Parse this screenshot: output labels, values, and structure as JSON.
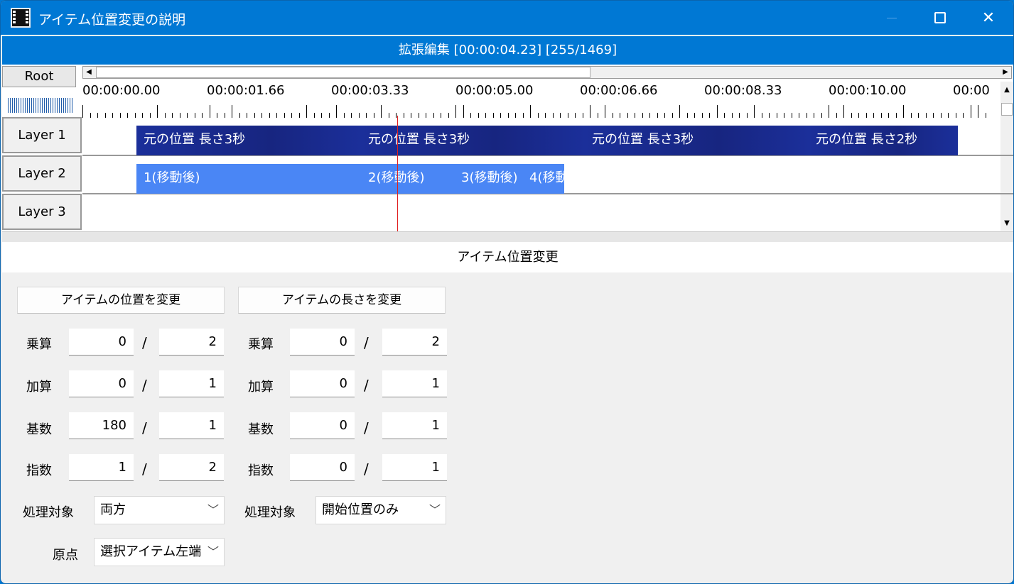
{
  "window": {
    "title": "アイテム位置変更の説明",
    "min": "",
    "max": "",
    "close": "✕"
  },
  "editor": {
    "header": "拡張編集 [00:00:04.23] [255/1469]",
    "root": "Root"
  },
  "ruler": {
    "labels": [
      "00:00:00.00",
      "00:00:01.66",
      "00:00:03.33",
      "00:00:05.00",
      "00:00:06.66",
      "00:00:08.33",
      "00:00:10.00",
      "00:00"
    ]
  },
  "layers": [
    "Layer  1",
    "Layer  2",
    "Layer  3"
  ],
  "clips": {
    "layer1": [
      "元の位置 長さ3秒",
      "元の位置 長さ3秒",
      "元の位置 長さ3秒",
      "元の位置 長さ2秒"
    ],
    "layer2": [
      "1(移動後)",
      "2(移動後)",
      "3(移動後)",
      "4(移動"
    ]
  },
  "panel": {
    "title": "アイテム位置変更",
    "position_button": "アイテムの位置を変更",
    "length_button": "アイテムの長さを変更",
    "labels": {
      "mul": "乗算",
      "add": "加算",
      "base": "基数",
      "exp": "指数",
      "target": "処理対象",
      "origin": "原点"
    },
    "slash": "/",
    "left": {
      "mul": [
        "0",
        "2"
      ],
      "add": [
        "0",
        "1"
      ],
      "base": [
        "180",
        "1"
      ],
      "exp": [
        "1",
        "2"
      ],
      "target": "両方",
      "origin": "選択アイテム左端"
    },
    "right": {
      "mul": [
        "0",
        "2"
      ],
      "add": [
        "0",
        "1"
      ],
      "base": [
        "0",
        "1"
      ],
      "exp": [
        "0",
        "1"
      ],
      "target": "開始位置のみ"
    }
  },
  "colors": {
    "titlebar": "#0078d4",
    "clip_dark": "#1b2f9a",
    "clip_light": "#4a86f5",
    "cursor": "#e02020"
  }
}
